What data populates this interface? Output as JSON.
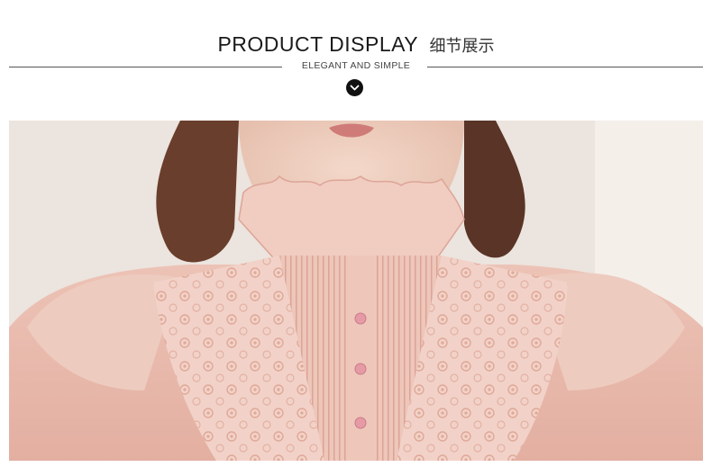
{
  "header": {
    "title_en": "PRODUCT DISPLAY",
    "title_cn": "细节展示",
    "subtitle": "ELEGANT AND SIMPLE",
    "divider_icon": "chevron-down-icon"
  },
  "photo": {
    "description_icon": "product-photo"
  },
  "colors": {
    "blouse": "#e8b9ac",
    "lace": "#f1cfc4",
    "accent": "#111111"
  }
}
